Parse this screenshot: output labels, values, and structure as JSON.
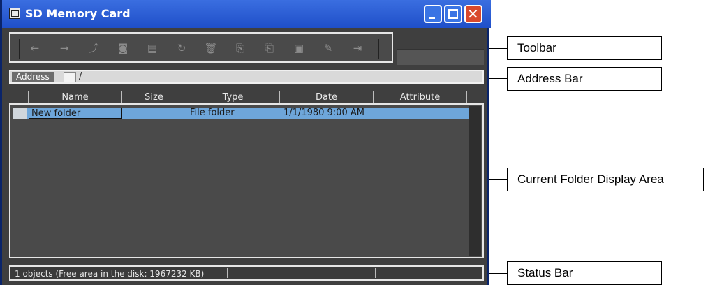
{
  "window": {
    "title": "SD Memory Card",
    "close_glyph": "✕"
  },
  "toolbar": {
    "icons": [
      "back-icon",
      "forward-icon",
      "up-folder-icon",
      "view-icon",
      "properties-icon",
      "refresh-icon",
      "delete-icon",
      "copy-icon",
      "paste-icon",
      "new-folder-icon",
      "rename-icon",
      "exit-icon"
    ],
    "glyphs": [
      "←",
      "→",
      "⤴",
      "◙",
      "▤",
      "↻",
      "🗑",
      "⎘",
      "⎗",
      "▣",
      "✎",
      "⇥"
    ]
  },
  "address": {
    "label": "Address",
    "path": "/"
  },
  "table": {
    "columns": [
      "Name",
      "Size",
      "Type",
      "Date",
      "Attribute"
    ],
    "rows": [
      {
        "name": "New folder",
        "size": "",
        "type": "File folder",
        "date": "1/1/1980 9:00 AM",
        "attribute": ""
      }
    ]
  },
  "status": {
    "text": "1 objects (Free area in the disk: 1967232 KB)"
  },
  "callouts": {
    "toolbar": "Toolbar",
    "address_bar": "Address Bar",
    "folder_area": "Current Folder Display Area",
    "status_bar": "Status Bar"
  },
  "colors": {
    "titlebar": "#2a5fd8",
    "selection": "#6ea6da",
    "close": "#d9492d"
  }
}
